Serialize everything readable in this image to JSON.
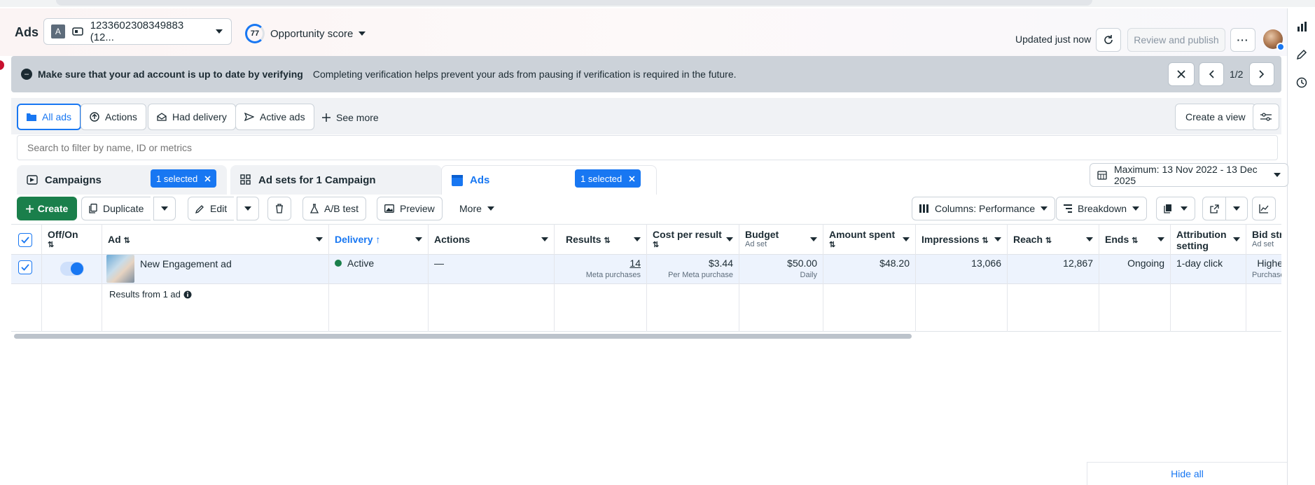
{
  "header": {
    "brand": "Ads",
    "account_badge": "A",
    "account_id": "1233602308349883 (12...",
    "opportunity_score": "77",
    "opportunity_label": "Opportunity score",
    "updated_text": "Updated just now",
    "review_publish": "Review and publish"
  },
  "banner": {
    "title": "Make sure that your ad account is up to date by verifying",
    "description": "Completing verification helps prevent your ads from pausing if verification is required in the future.",
    "pager": "1/2"
  },
  "tabs": {
    "all_ads": "All ads",
    "actions": "Actions",
    "had_delivery": "Had delivery",
    "active_ads": "Active ads",
    "see_more": "See more",
    "create_view": "Create a view"
  },
  "search": {
    "placeholder": "Search to filter by name, ID or metrics"
  },
  "levels": {
    "campaigns": "Campaigns",
    "campaigns_selected": "1 selected",
    "adsets": "Ad sets for 1 Campaign",
    "ads": "Ads",
    "ads_selected": "1 selected",
    "date_range": "Maximum: 13 Nov 2022 - 13 Dec 2025"
  },
  "toolbar": {
    "create": "Create",
    "duplicate": "Duplicate",
    "edit": "Edit",
    "ab_test": "A/B test",
    "preview": "Preview",
    "more": "More",
    "columns": "Columns: Performance",
    "breakdown": "Breakdown"
  },
  "table": {
    "headers": {
      "offon": "Off/On",
      "ad": "Ad",
      "delivery": "Delivery",
      "actions": "Actions",
      "results": "Results",
      "cpr": "Cost per result",
      "budget": "Budget",
      "budget_sub": "Ad set",
      "amount": "Amount spent",
      "impressions": "Impressions",
      "reach": "Reach",
      "ends": "Ends",
      "attribution": "Attribution setting",
      "bid": "Bid stra",
      "bid_sub": "Ad set"
    },
    "row": {
      "ad_name": "New Engagement ad",
      "delivery": "Active",
      "actions": "—",
      "results": "14",
      "results_sub": "Meta purchases",
      "cpr": "$3.44",
      "cpr_sub": "Per Meta purchase",
      "budget": "$50.00",
      "budget_sub": "Daily",
      "amount": "$48.20",
      "impressions": "13,066",
      "reach": "12,867",
      "ends": "Ongoing",
      "attribution": "1-day click",
      "bid": "Highe",
      "bid_sub": "Purchase"
    },
    "results_from": "Results from 1 ad"
  },
  "footer": {
    "hide_all": "Hide all"
  },
  "colors": {
    "accent": "#1877f2",
    "create_green": "#1a7f4b",
    "banner": "#ccd2d9"
  }
}
